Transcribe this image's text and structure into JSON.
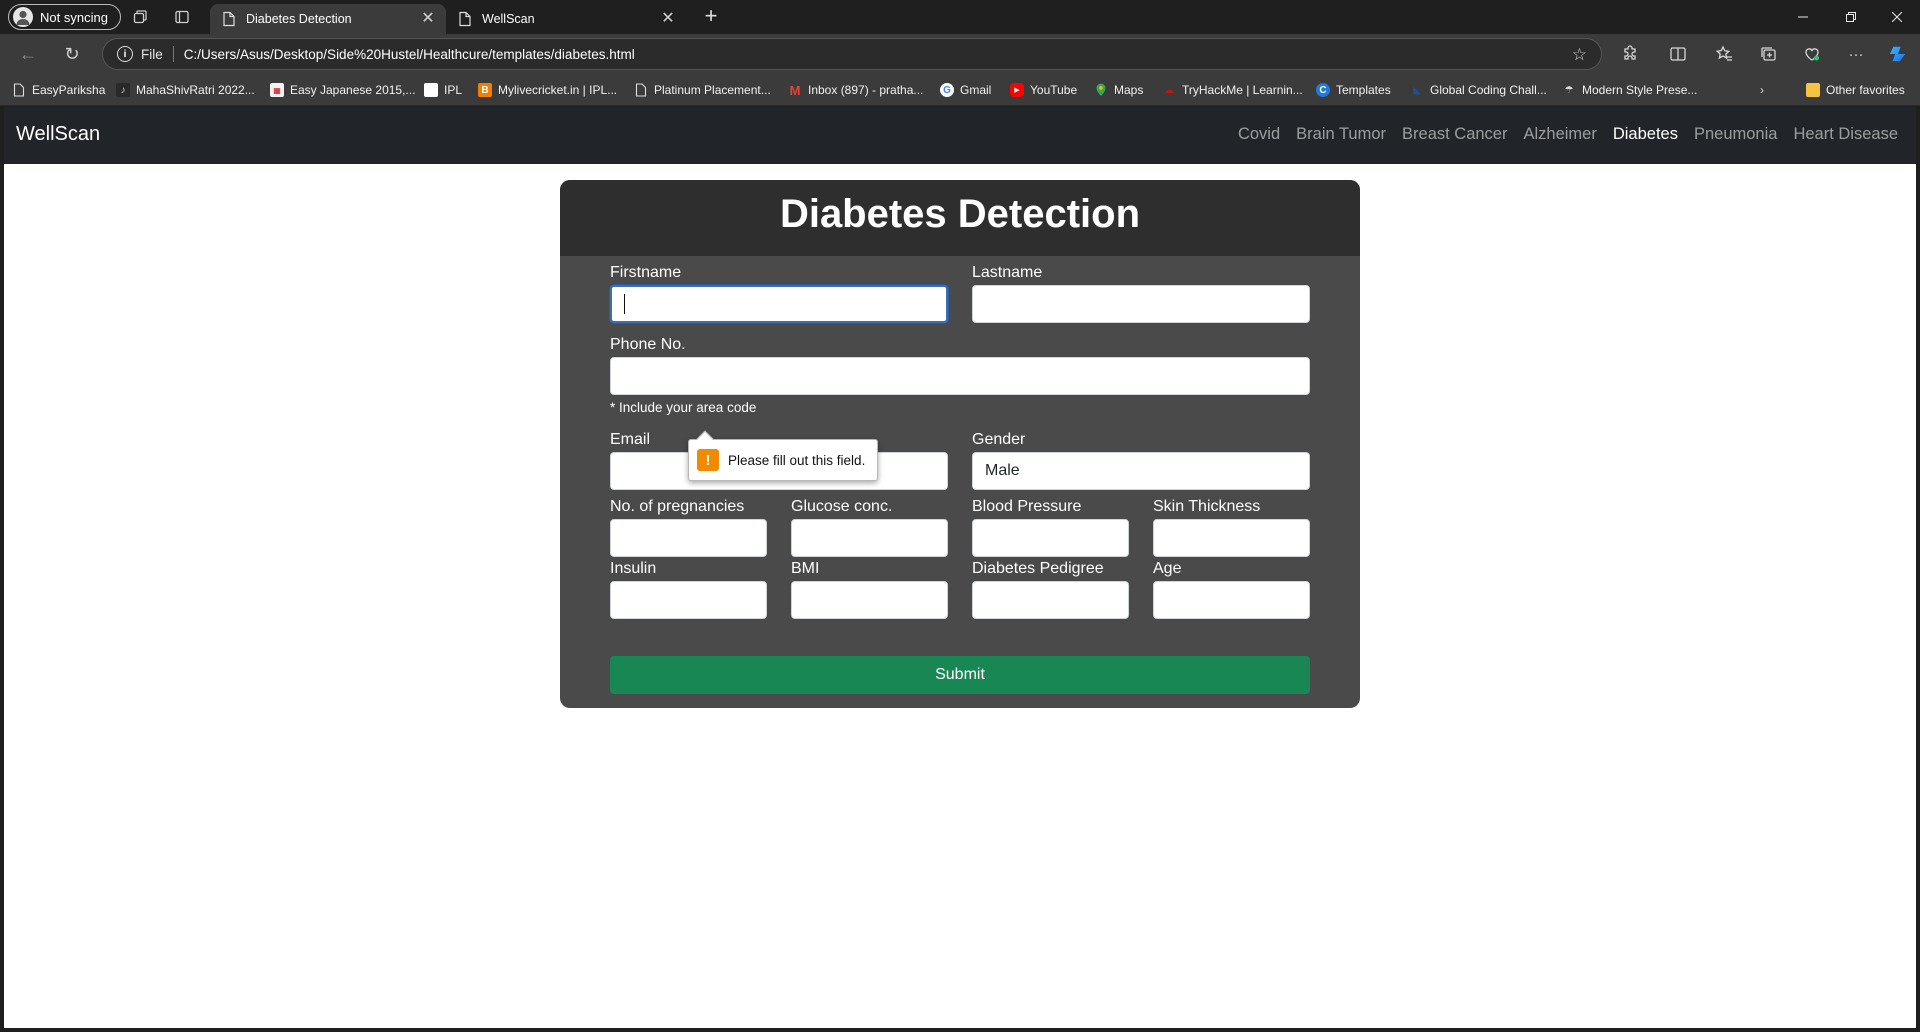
{
  "browser": {
    "profile_label": "Not syncing",
    "tabs": [
      {
        "title": "Diabetes Detection",
        "active": true
      },
      {
        "title": "WellScan",
        "active": false
      }
    ],
    "address": {
      "scheme": "File",
      "url": "C:/Users/Asus/Desktop/Side%20Hustel/Healthcure/templates/diabetes.html"
    },
    "bookmarks": [
      {
        "label": "EasyPariksha",
        "icon": "page-icon"
      },
      {
        "label": "MahaShivRatri 2022...",
        "icon": "figure-icon"
      },
      {
        "label": "Easy Japanese 2015,...",
        "icon": "calendar-icon"
      },
      {
        "label": "IPL",
        "icon": "blank-icon"
      },
      {
        "label": "Mylivecricket.in | IPL...",
        "icon": "blogger-icon"
      },
      {
        "label": "Platinum Placement...",
        "icon": "page-icon"
      },
      {
        "label": "Inbox (897) - pratha...",
        "icon": "gmail-icon"
      },
      {
        "label": "Gmail",
        "icon": "google-icon"
      },
      {
        "label": "YouTube",
        "icon": "youtube-icon"
      },
      {
        "label": "Maps",
        "icon": "maps-icon"
      },
      {
        "label": "TryHackMe | Learnin...",
        "icon": "tryhackme-icon"
      },
      {
        "label": "Templates",
        "icon": "canva-icon"
      },
      {
        "label": "Global Coding Chall...",
        "icon": "coding-icon"
      },
      {
        "label": "Modern Style Prese...",
        "icon": "presentation-icon"
      }
    ],
    "other_favorites": "Other favorites"
  },
  "navbar": {
    "brand": "WellScan",
    "links": [
      "Covid",
      "Brain Tumor",
      "Breast Cancer",
      "Alzheimer",
      "Diabetes",
      "Pneumonia",
      "Heart Disease"
    ],
    "active_link": "Diabetes"
  },
  "form": {
    "title": "Diabetes Detection",
    "firstname_label": "Firstname",
    "lastname_label": "Lastname",
    "phone_label": "Phone No.",
    "phone_hint": "* Include your area code",
    "email_label": "Email",
    "gender_label": "Gender",
    "gender_value": "Male",
    "pregnancies_label": "No. of pregnancies",
    "glucose_label": "Glucose conc.",
    "bp_label": "Blood Pressure",
    "skin_label": "Skin Thickness",
    "insulin_label": "Insulin",
    "bmi_label": "BMI",
    "pedigree_label": "Diabetes Pedigree",
    "age_label": "Age",
    "submit_label": "Submit",
    "validation_message": "Please fill out this field."
  },
  "colors": {
    "navbar_bg": "#212529",
    "card_header_bg": "#2e2e2e",
    "card_body_bg": "#4a4a4a",
    "submit_bg": "#198754",
    "warning": "#f08a00"
  }
}
